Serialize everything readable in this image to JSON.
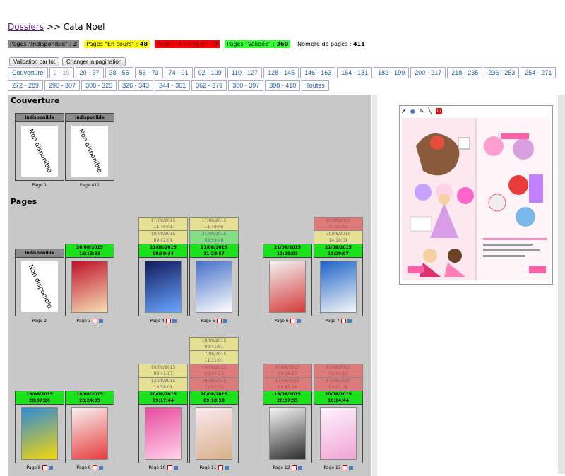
{
  "breadcrumb": {
    "link": "Dossiers",
    "sep": ">>",
    "current": "Cata Noel"
  },
  "legend": {
    "indisponible": {
      "label": "Pages \"Indisponible\" :",
      "count": "3"
    },
    "encours": {
      "label": "Pages \"En cours\" :",
      "count": "48"
    },
    "acorriger": {
      "label": "Pages \"A corriger\" :",
      "count": "0"
    },
    "validee": {
      "label": "Pages \"Validée\" :",
      "count": "360"
    },
    "total": {
      "label": "Nombre de pages :",
      "count": "411"
    }
  },
  "buttons": {
    "validation": "Validation par lot",
    "pagination": "Changer la pagination"
  },
  "pagination": [
    "Couverture",
    "2 - 19",
    "20 - 37",
    "38 - 55",
    "56 - 73",
    "74 - 91",
    "92 - 109",
    "110 - 127",
    "128 - 145",
    "146 - 163",
    "164 - 181",
    "182 - 199",
    "200 - 217",
    "218 - 235",
    "236 - 253",
    "254 - 271",
    "272 - 289",
    "290 - 307",
    "308 - 325",
    "326 - 343",
    "344 - 361",
    "362 - 379",
    "380 - 397",
    "398 - 410",
    "Toutes"
  ],
  "sections": {
    "couverture": "Couverture",
    "pages": "Pages"
  },
  "nondispo": "Non disponible",
  "status_indispo": "Indisponible",
  "cover": [
    {
      "caption": "Page 1"
    },
    {
      "caption": "Page 411"
    }
  ],
  "row1": [
    {
      "caption": "Page 2",
      "status": "Indisponible",
      "history": []
    },
    {
      "caption": "Page 3",
      "status": "20/08/2015\n15:13:33",
      "history": []
    },
    {
      "caption": "Page 4",
      "status": "21/08/2015\n08:59:34",
      "history": [
        [
          "y",
          "17/08/2015\n11:49:01"
        ],
        [
          "y",
          "19/08/2015\n09:42:01"
        ]
      ]
    },
    {
      "caption": "Page 5",
      "status": "21/08/2015\n11:28:57",
      "history": [
        [
          "y",
          "17/08/2015\n11:49:06"
        ],
        [
          "g",
          "21/08/2015\n08:59:40"
        ]
      ]
    },
    {
      "caption": "Page 6",
      "status": "21/08/2015\n11:29:03",
      "history": []
    },
    {
      "caption": "Page 7",
      "status": "21/08/2015\n11:29:07",
      "history": [
        [
          "r",
          "20/08/2015\n11:12:17"
        ],
        [
          "y",
          "20/08/2015\n14:18:01"
        ]
      ]
    }
  ],
  "row2": [
    {
      "caption": "Page 8",
      "status": "19/08/2015\n20:07:26",
      "history": []
    },
    {
      "caption": "Page 9",
      "status": "19/08/2015\n20:24:05",
      "history": []
    },
    {
      "caption": "Page 10",
      "status": "20/08/2015\n09:17:44",
      "history": [
        [
          "y",
          "10/08/2015\n09:41:17"
        ],
        [
          "y",
          "12/08/2015\n18:58:01"
        ]
      ]
    },
    {
      "caption": "Page 11",
      "status": "20/08/2015\n09:18:58",
      "history": [
        [
          "y",
          "10/08/2015\n09:41:01"
        ],
        [
          "y",
          "17/08/2015\n11:31:01"
        ],
        [
          "r",
          "18/08/2015\n20:07:23"
        ],
        [
          "r",
          "18/08/2015\n18:53:32"
        ]
      ]
    },
    {
      "caption": "Page 12",
      "status": "19/08/2015\n20:07:55",
      "history": [
        [
          "r",
          "10/08/2015\n09:36:23"
        ],
        [
          "r",
          "17/08/2015\n09:43:28"
        ]
      ]
    },
    {
      "caption": "Page 13",
      "status": "20/08/2015\n10:14:44",
      "history": [
        [
          "r",
          "10/08/2015\n09:44:13"
        ],
        [
          "r",
          "17/08/2015\n09:51:28"
        ]
      ]
    }
  ]
}
